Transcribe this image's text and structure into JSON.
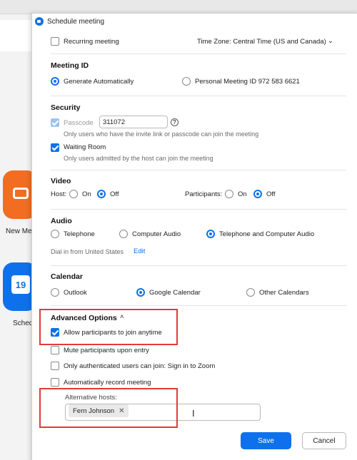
{
  "background_app": {
    "tiles": [
      {
        "label": "New Me",
        "color": "#f26d21"
      },
      {
        "label": "Sched",
        "color": "#0e71eb",
        "calendar_day": "19"
      }
    ]
  },
  "dialog": {
    "title": "Schedule meeting",
    "recurring": {
      "label": "Recurring meeting",
      "checked": false
    },
    "timezone": {
      "label": "Time Zone: Central Time (US and Canada)"
    },
    "meeting_id": {
      "title": "Meeting ID",
      "options": [
        {
          "label": "Generate Automatically",
          "selected": true
        },
        {
          "label": "Personal Meeting ID 972 583 6621",
          "selected": false
        }
      ]
    },
    "security": {
      "title": "Security",
      "passcode": {
        "label": "Passcode",
        "value": "311072",
        "checked": true,
        "disabled": true
      },
      "passcode_hint": "Only users who have the invite link or passcode can join the meeting",
      "waiting_room": {
        "label": "Waiting Room",
        "checked": true
      },
      "waiting_hint": "Only users admitted by the host can join the meeting"
    },
    "video": {
      "title": "Video",
      "host_label": "Host:",
      "participants_label": "Participants:",
      "on": "On",
      "off": "Off",
      "host_value": "Off",
      "participants_value": "Off"
    },
    "audio": {
      "title": "Audio",
      "options": [
        {
          "label": "Telephone",
          "selected": false
        },
        {
          "label": "Computer Audio",
          "selected": false
        },
        {
          "label": "Telephone and Computer Audio",
          "selected": true
        }
      ],
      "dial_in": "Dial in from United States",
      "edit": "Edit"
    },
    "calendar": {
      "title": "Calendar",
      "options": [
        {
          "label": "Outlook",
          "selected": false
        },
        {
          "label": "Google Calendar",
          "selected": true
        },
        {
          "label": "Other Calendars",
          "selected": false
        }
      ]
    },
    "advanced": {
      "title": "Advanced Options",
      "options": [
        {
          "label": "Allow participants to join anytime",
          "checked": true
        },
        {
          "label": "Mute participants upon entry",
          "checked": false
        },
        {
          "label": "Only authenticated users can join: Sign in to Zoom",
          "checked": false
        },
        {
          "label": "Automatically record meeting",
          "checked": false
        }
      ],
      "alt_hosts_label": "Alternative hosts:",
      "alt_hosts": [
        "Fern Johnson"
      ]
    },
    "buttons": {
      "save": "Save",
      "cancel": "Cancel"
    },
    "colors": {
      "accent": "#0e71eb",
      "highlight": "#e03b3b"
    }
  }
}
